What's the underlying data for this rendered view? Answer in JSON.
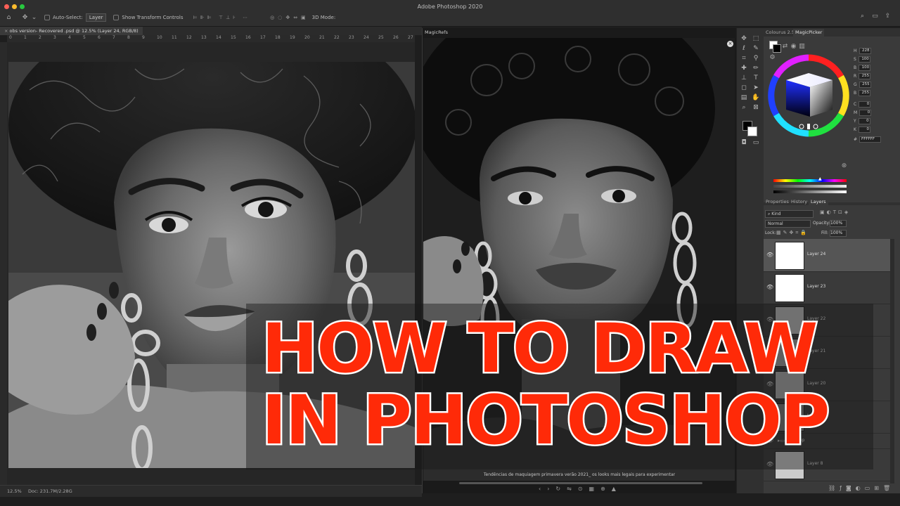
{
  "titlebar": {
    "app_title": "Adobe Photoshop 2020",
    "traffic_colors": [
      "#ff5f57",
      "#febc2e",
      "#28c840"
    ]
  },
  "options_bar": {
    "auto_select_label": "Auto-Select:",
    "auto_select_value": "Layer",
    "show_transform_label": "Show Transform Controls",
    "mode_label": "3D Mode:"
  },
  "document": {
    "tab_title": "obs version- Recovered .psd @ 12.5% (Layer 24, RGB/8)",
    "ruler_numbers": [
      "0",
      "1",
      "2",
      "3",
      "4",
      "5",
      "6",
      "7",
      "8",
      "9",
      "10",
      "11",
      "12",
      "13",
      "14",
      "15",
      "16",
      "17",
      "18",
      "19",
      "20",
      "21",
      "22",
      "23",
      "24",
      "25",
      "26",
      "27",
      "28"
    ],
    "zoom": "12.5%",
    "doc_size": "Doc: 231.7M/2.28G"
  },
  "ref_panel": {
    "tab": "MagicRefs",
    "caption": "Tendências de maquiagem primavera verão 2021_ os looks mais legais para experimentar",
    "nav_icons": [
      "chevron-left",
      "chevron-right",
      "rotate",
      "flip",
      "pin",
      "grid",
      "zoom",
      "color"
    ]
  },
  "color_panel": {
    "tabs": [
      "Colourus 2.5",
      "MagicPicker"
    ],
    "active_tab": 1,
    "values": [
      {
        "label": "H",
        "value": "228"
      },
      {
        "label": "S",
        "value": "100"
      },
      {
        "label": "B",
        "value": "100"
      },
      {
        "label": "R",
        "value": "255"
      },
      {
        "label": "G",
        "value": "255"
      },
      {
        "label": "B",
        "value": "255"
      },
      {
        "label": "C",
        "value": "0"
      },
      {
        "label": "M",
        "value": "0"
      },
      {
        "label": "Y",
        "value": "0"
      },
      {
        "label": "K",
        "value": "0"
      }
    ],
    "hex": "FFFFFF",
    "foreground": "#000000",
    "background": "#ffffff"
  },
  "layers_panel": {
    "tabs": [
      "Properties",
      "History",
      "Layers"
    ],
    "active_tab": 2,
    "filter_label": "Kind",
    "blend_mode": "Normal",
    "opacity_label": "Opacity:",
    "opacity_value": "100%",
    "lock_label": "Lock:",
    "fill_label": "Fill:",
    "fill_value": "100%",
    "layers": [
      {
        "name": "Layer 24",
        "selected": true
      },
      {
        "name": "Layer 23",
        "selected": false
      },
      {
        "name": "Layer 22",
        "selected": false
      },
      {
        "name": "Layer 21",
        "selected": false
      },
      {
        "name": "Layer 20",
        "selected": false
      },
      {
        "name": "Layer 19",
        "selected": false
      },
      {
        "name": "Group",
        "selected": false
      },
      {
        "name": "Layer 8",
        "selected": false
      }
    ]
  },
  "overlay": {
    "line1": "HOW TO DRAW",
    "line2": "IN PHOTOSHOP",
    "text_color": "#ff2a08"
  }
}
